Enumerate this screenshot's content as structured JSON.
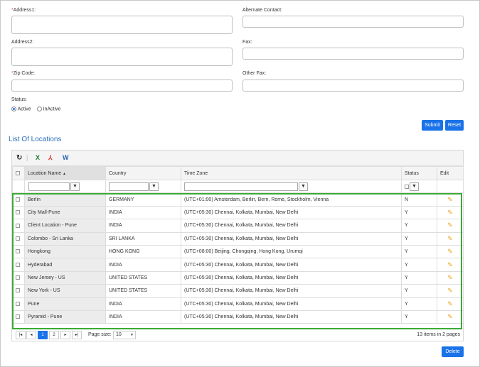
{
  "form": {
    "required_mark": "*",
    "address1_label": "Address1:",
    "address2_label": "Address2:",
    "zip_label": "Zip Code:",
    "alternate_contact_label": "Alternate Contact:",
    "fax_label": "Fax:",
    "other_fax_label": "Other Fax:",
    "status_label": "Status:",
    "status_options": [
      "Active",
      "InActive"
    ],
    "status_selected": "Active",
    "submit_label": "Submit",
    "reset_label": "Reset"
  },
  "locations": {
    "title": "List Of Locations",
    "toolbar_icons": [
      "refresh-icon",
      "excel-export-icon",
      "pdf-export-icon",
      "word-export-icon"
    ],
    "columns": [
      "Location Name",
      "Country",
      "Time Zone",
      "Status",
      "Edit"
    ],
    "sort_indicator": "▲",
    "rows": [
      {
        "name": "Berlin",
        "country": "GERMANY",
        "tz": "(UTC+01:00) Amsterdam, Berlin, Bern, Rome, Stockholm, Vienna",
        "status": "N"
      },
      {
        "name": "City Mall-Pune",
        "country": "INDIA",
        "tz": "(UTC+05:30) Chennai, Kolkata, Mumbai, New Delhi",
        "status": "Y"
      },
      {
        "name": "Client Location - Pune",
        "country": "INDIA",
        "tz": "(UTC+05:30) Chennai, Kolkata, Mumbai, New Delhi",
        "status": "Y"
      },
      {
        "name": "Colombo - Sri Lanka",
        "country": "SRI LANKA",
        "tz": "(UTC+05:30) Chennai, Kolkata, Mumbai, New Delhi",
        "status": "Y"
      },
      {
        "name": "Hongkong",
        "country": "HONG KONG",
        "tz": "(UTC+08:00) Beijing, Chongqing, Hong Kong, Urumqi",
        "status": "Y"
      },
      {
        "name": "Hyderabad",
        "country": "INDIA",
        "tz": "(UTC+05:30) Chennai, Kolkata, Mumbai, New Delhi",
        "status": "Y"
      },
      {
        "name": "New Jersey - US",
        "country": "UNITED STATES",
        "tz": "(UTC+05:30) Chennai, Kolkata, Mumbai, New Delhi",
        "status": "Y"
      },
      {
        "name": "New York - US",
        "country": "UNITED STATES",
        "tz": "(UTC+05:30) Chennai, Kolkata, Mumbai, New Delhi",
        "status": "Y"
      },
      {
        "name": "Pune",
        "country": "INDIA",
        "tz": "(UTC+05:30) Chennai, Kolkata, Mumbai, New Delhi",
        "status": "Y"
      },
      {
        "name": "Pyramid - Pune",
        "country": "INDIA",
        "tz": "(UTC+05:30) Chennai, Kolkata, Mumbai, New Delhi",
        "status": "Y"
      }
    ],
    "pager": {
      "first": "|◂",
      "prev": "◂",
      "pages": [
        "1",
        "2"
      ],
      "current_page": "1",
      "next": "▸",
      "last": "▸|",
      "page_size_label": "Page size:",
      "page_size_value": "10",
      "summary": "13 items in 2 pages"
    },
    "delete_label": "Delete"
  },
  "colors": {
    "accent": "#1a73e8",
    "title": "#2a6ebb",
    "highlight_border": "#3aaa35",
    "edit_icon": "#e8a317"
  }
}
